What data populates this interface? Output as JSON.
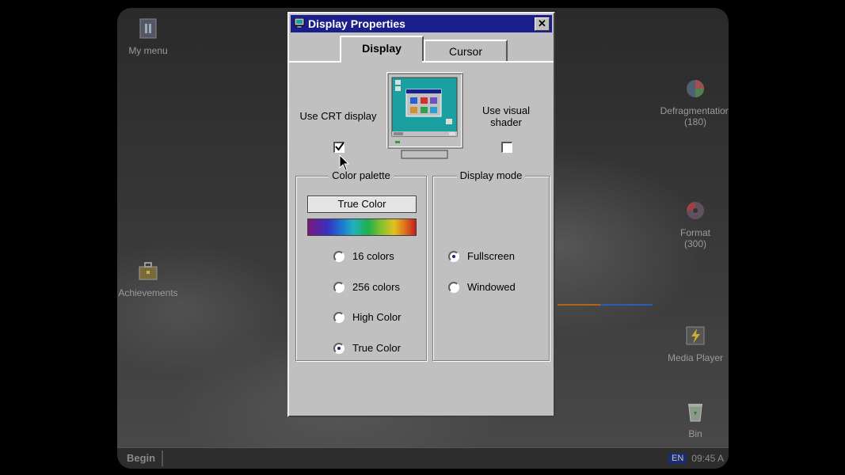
{
  "desktop": {
    "icons": [
      {
        "label": "My menu",
        "icon": "menu-folder-icon"
      },
      {
        "label": "Achievements",
        "icon": "toolbox-icon"
      },
      {
        "label": "Defragmentation",
        "sub": "(180)",
        "icon": "defrag-icon"
      },
      {
        "label": "Format",
        "sub": "(300)",
        "icon": "disk-icon"
      },
      {
        "label": "Media Player",
        "icon": "media-player-icon"
      },
      {
        "label": "Bin",
        "icon": "recycle-bin-icon"
      }
    ]
  },
  "taskbar": {
    "start_label": "Begin",
    "language": "EN",
    "clock": "09:45 A"
  },
  "window": {
    "title": "Display Properties",
    "close_label": "✕",
    "tabs": [
      {
        "label": "Display",
        "active": true
      },
      {
        "label": "Cursor",
        "active": false
      }
    ],
    "crt": {
      "label": "Use CRT display",
      "checked": true
    },
    "shader": {
      "label": "Use visual shader",
      "checked": false
    },
    "palette": {
      "title": "Color palette",
      "current": "True Color",
      "options": [
        {
          "label": "16 colors",
          "selected": false
        },
        {
          "label": "256 colors",
          "selected": false
        },
        {
          "label": "High Color",
          "selected": false
        },
        {
          "label": "True Color",
          "selected": true
        }
      ]
    },
    "display_mode": {
      "title": "Display mode",
      "options": [
        {
          "label": "Fullscreen",
          "selected": true
        },
        {
          "label": "Windowed",
          "selected": false
        }
      ]
    }
  },
  "colors": {
    "titlebar": "#1b1f8c",
    "window_face": "#c0c0c0",
    "monitor_screen": "#1aa0a0"
  }
}
